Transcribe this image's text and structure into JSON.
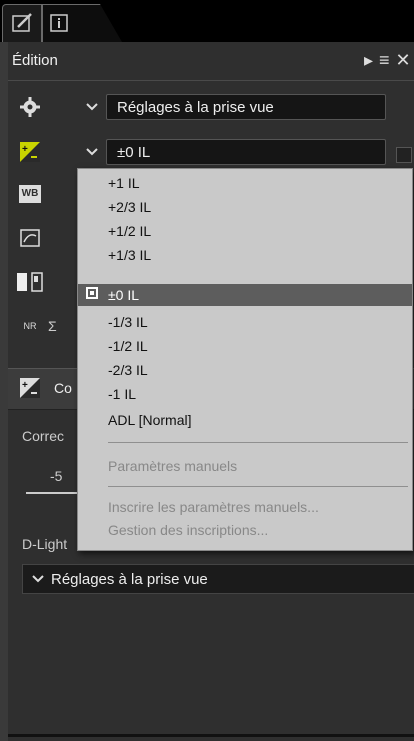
{
  "panel": {
    "title": "Édition"
  },
  "settings_row": {
    "value": "Réglages à la prise vue"
  },
  "exposure_row": {
    "value": "±0 IL"
  },
  "left_icons": {
    "wb_label": "WB",
    "nr_label": "NR"
  },
  "menu": {
    "items": [
      "+1 IL",
      "+2/3 IL",
      "+1/2 IL",
      "+1/3 IL",
      "±0 IL",
      "-1/3 IL",
      "-1/2 IL",
      "-2/3 IL",
      "-1 IL",
      "ADL [Normal]"
    ],
    "selected_index": 4,
    "manual_label": "Paramètres manuels",
    "register_label": "Inscrire les paramètres manuels...",
    "manage_label": "Gestion des inscriptions..."
  },
  "section": {
    "title": "Co"
  },
  "correction": {
    "label": "Correc",
    "value": "-5"
  },
  "dlighting": {
    "label": "D-Light",
    "value": "Réglages à la prise vue"
  }
}
